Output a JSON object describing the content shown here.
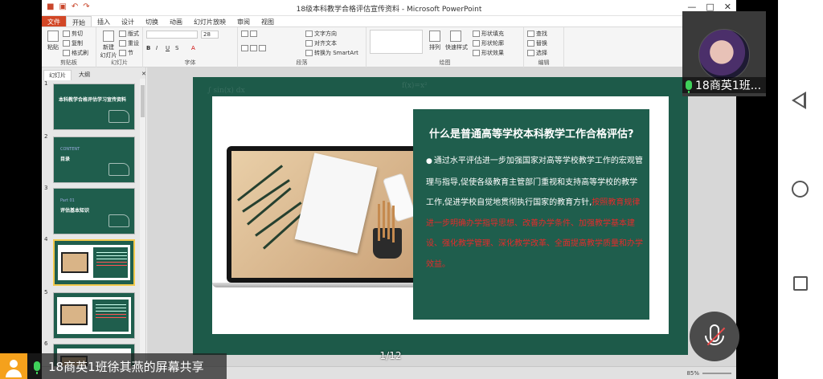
{
  "window": {
    "title": "18级本科教学合格评估宣传资料 - Microsoft PowerPoint",
    "controls": [
      "—",
      "□",
      "✕"
    ]
  },
  "ribbon_tabs": [
    "文件",
    "开始",
    "插入",
    "设计",
    "切换",
    "动画",
    "幻灯片放映",
    "审阅",
    "视图"
  ],
  "ribbon": {
    "clipboard": {
      "paste": "粘贴",
      "cut": "剪切",
      "copy": "复制",
      "format_painter": "格式刷",
      "label": "剪贴板"
    },
    "slides": {
      "new_slide": "新建\n幻灯片",
      "layout": "版式",
      "reset": "重设",
      "section": "节",
      "label": "幻灯片"
    },
    "font": {
      "size": "28",
      "label": "字体"
    },
    "paragraph": {
      "text_direction": "文字方向",
      "align_text": "对齐文本",
      "smartart": "转换为 SmartArt",
      "label": "段落"
    },
    "drawing": {
      "arrange": "排列",
      "quick_styles": "快速样式",
      "shape_fill": "形状填充",
      "shape_outline": "形状轮廓",
      "shape_effects": "形状效果",
      "label": "绘图"
    },
    "editing": {
      "find": "查找",
      "replace": "替换",
      "select": "选择",
      "label": "编辑"
    }
  },
  "panel": {
    "tabs": [
      "幻灯片",
      "大纲"
    ],
    "thumbnails": [
      {
        "num": "1",
        "title": "本科教学合格评估学习宣传资料"
      },
      {
        "num": "2",
        "title": "目录",
        "sub": "CONTENT"
      },
      {
        "num": "3",
        "title": "评估基本知识",
        "sub": "Part 01"
      },
      {
        "num": "4",
        "title": ""
      },
      {
        "num": "5",
        "title": ""
      },
      {
        "num": "6",
        "title": ""
      }
    ]
  },
  "slide": {
    "heading": "什么是普通高等学校本科教学工作合格评估?",
    "bullet": "●",
    "body_white": "通过水平评估进一步加强国家对高等学校教学工作的宏观管理与指导,促使各级教育主管部门重视和支持高等学校的教学工作,促进学校自觉地贯彻执行国家的教育方针,",
    "body_red": "按照教育规律进一步明确办学指导思想、改善办学条件、加强教学基本建设、强化教学管理、深化教学改革、全面提高教学质量和办学效益。"
  },
  "page_counter": "1/12",
  "status": {
    "zoom": "85%"
  },
  "meeting": {
    "video_name": "18商英1班...",
    "share_label": "18商英1班徐其燕的屏幕共享"
  }
}
